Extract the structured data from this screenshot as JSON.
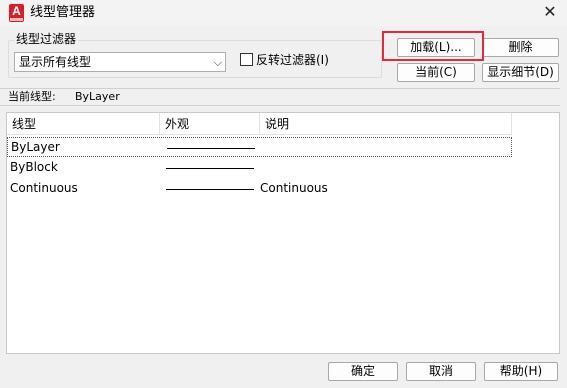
{
  "window": {
    "title": "线型管理器",
    "app_icon_letter": "A",
    "close_glyph": "✕"
  },
  "filter": {
    "group_label": "线型过滤器",
    "select_value": "显示所有线型",
    "invert_label": "反转过滤器(I)",
    "invert_checked": false
  },
  "buttons": {
    "load": "加载(L)...",
    "delete": "删除",
    "current": "当前(C)",
    "details": "显示细节(D)",
    "ok": "确定",
    "cancel": "取消",
    "help": "帮助(H)"
  },
  "current_linetype": {
    "label": "当前线型:",
    "value": "ByLayer"
  },
  "table": {
    "columns": [
      "线型",
      "外观",
      "说明"
    ],
    "rows": [
      {
        "name": "ByLayer",
        "description": "",
        "selected": true
      },
      {
        "name": "ByBlock",
        "description": "",
        "selected": false
      },
      {
        "name": "Continuous",
        "description": "Continuous",
        "selected": false
      }
    ]
  },
  "colors": {
    "highlight": "#e02b3c",
    "app_icon": "#d4202b"
  }
}
